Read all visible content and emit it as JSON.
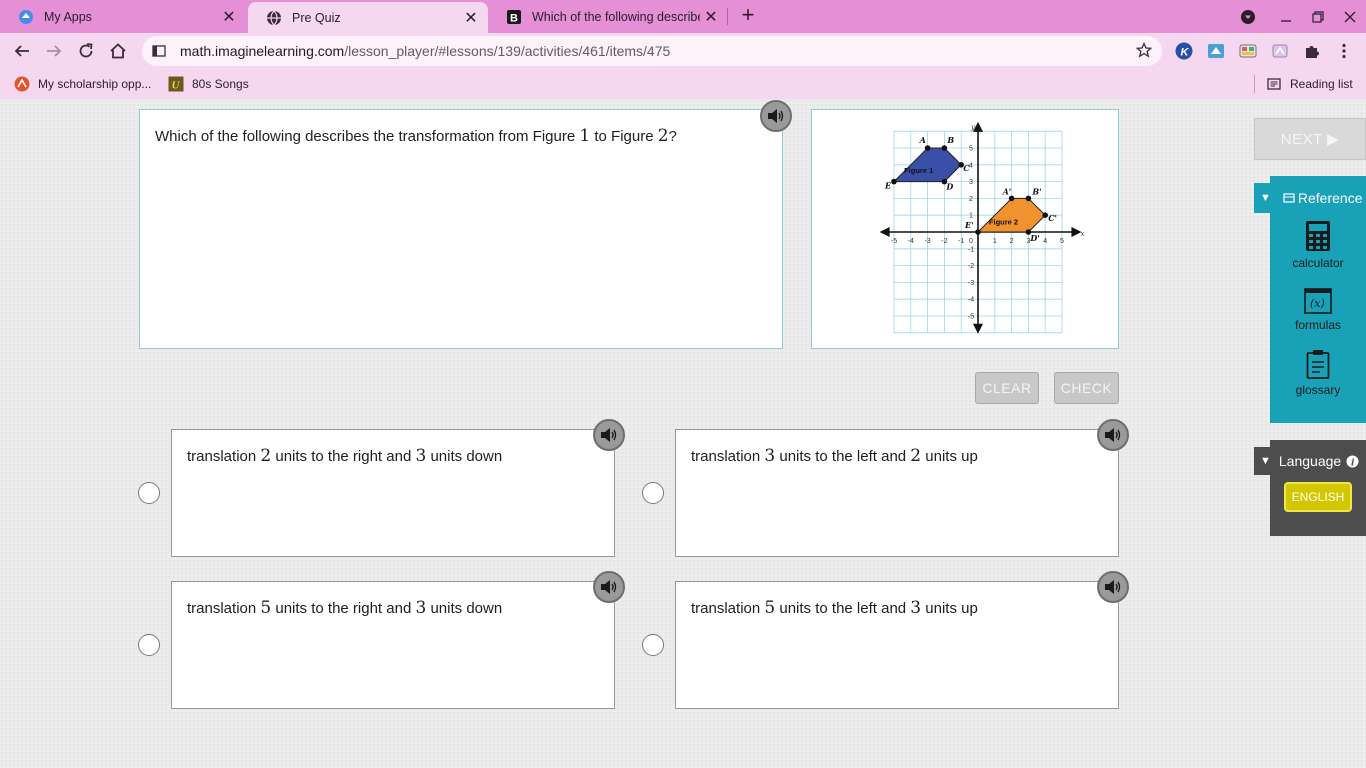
{
  "browser": {
    "tabs": [
      {
        "title": "My Apps",
        "icon": "imagine-learning-icon"
      },
      {
        "title": "Pre Quiz",
        "icon": "globe-icon"
      },
      {
        "title": "Which of the following describes",
        "icon": "brainly-icon"
      }
    ],
    "url_host": "math.imaginelearning.com",
    "url_path": "/lesson_player/#lessons/139/activities/461/items/475",
    "bookmarks": [
      {
        "label": "My scholarship opp...",
        "icon": "scholarship-icon"
      },
      {
        "label": "80s Songs",
        "icon": "u-bookmark-icon"
      }
    ],
    "reading_list": "Reading list"
  },
  "question": {
    "text_before": "Which of the following describes the transformation from Figure ",
    "num1": "1",
    "text_middle": " to Figure ",
    "num2": "2",
    "text_after": "?"
  },
  "graph": {
    "figure1_label": "Figure 1",
    "figure2_label": "Figure 2",
    "figure1_points": [
      [
        "A",
        -3,
        5
      ],
      [
        "B",
        -2,
        5
      ],
      [
        "C",
        -1,
        4
      ],
      [
        "D",
        -2,
        3
      ],
      [
        "E",
        -5,
        3
      ]
    ],
    "figure2_points": [
      [
        "A'",
        2,
        2
      ],
      [
        "B'",
        3,
        2
      ],
      [
        "C'",
        4,
        1
      ],
      [
        "D'",
        3,
        0
      ],
      [
        "E'",
        0,
        0
      ]
    ],
    "x_ticks": [
      "-5",
      "-4",
      "-3",
      "-2",
      "-1",
      "0",
      "1",
      "2",
      "3",
      "4",
      "5"
    ],
    "y_ticks": [
      "5",
      "4",
      "3",
      "2",
      "1",
      "-1",
      "-2",
      "-3",
      "-4",
      "-5"
    ],
    "x_axis": "x",
    "y_axis": "y",
    "colors": {
      "figure1": "#3a4fa8",
      "figure2": "#f0922e",
      "grid": "#9fd6e8"
    }
  },
  "controls": {
    "clear": "CLEAR",
    "check": "CHECK",
    "next": "NEXT ▶"
  },
  "answers": [
    {
      "before": "translation ",
      "n1": "2",
      "middle": " units to the right and ",
      "n2": "3",
      "after": " units down"
    },
    {
      "before": "translation ",
      "n1": "3",
      "middle": " units to the left and ",
      "n2": "2",
      "after": " units up"
    },
    {
      "before": "translation ",
      "n1": "5",
      "middle": " units to the right and ",
      "n2": "3",
      "after": " units down"
    },
    {
      "before": "translation ",
      "n1": "5",
      "middle": " units to the left and ",
      "n2": "3",
      "after": " units up"
    }
  ],
  "sidebar": {
    "reference_label": "Reference",
    "tools": [
      {
        "label": "calculator",
        "icon": "calculator-icon"
      },
      {
        "label": "formulas",
        "icon": "formulas-icon"
      },
      {
        "label": "glossary",
        "icon": "glossary-icon"
      }
    ],
    "language_label": "Language",
    "language_value": "ENGLISH"
  }
}
